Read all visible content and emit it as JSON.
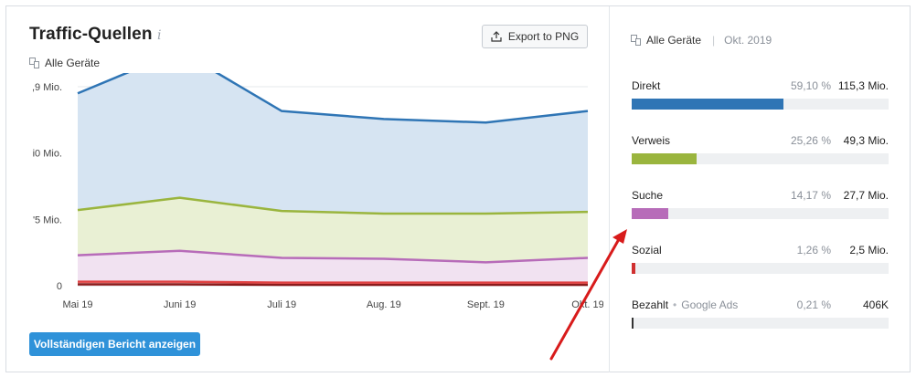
{
  "header": {
    "title": "Traffic-Quellen",
    "info_glyph": "i",
    "device_filter": "Alle Geräte",
    "export_label": "Export to PNG"
  },
  "chart_data": {
    "type": "area",
    "x": [
      "Mai 19",
      "Juni 19",
      "Juli 19",
      "Aug. 19",
      "Sept. 19",
      "Okt. 19"
    ],
    "y_tick_labels": [
      ",9 Mio.",
      "i0 Mio.",
      "'5 Mio.",
      "0"
    ],
    "y_tick_values": [
      225,
      150,
      75,
      0
    ],
    "ylim": [
      0,
      225
    ],
    "grid": true,
    "stacked": true,
    "series": [
      {
        "name": "Bezahlt",
        "color": "#8b1a1a",
        "values": [
          1.5,
          1.5,
          1.0,
          1.0,
          1.0,
          1.0
        ]
      },
      {
        "name": "Sozial",
        "color": "#e04040",
        "values": [
          3.0,
          3.0,
          2.5,
          2.5,
          2.5,
          2.5
        ]
      },
      {
        "name": "Suche",
        "color": "#b76cb9",
        "values": [
          30,
          35,
          28,
          27,
          23,
          28
        ]
      },
      {
        "name": "Verweis",
        "color": "#9ab53e",
        "values": [
          51,
          60,
          53,
          51,
          55,
          52
        ]
      },
      {
        "name": "Direkt",
        "color": "#2f75b5",
        "values": [
          132,
          166,
          113,
          107,
          103,
          114
        ]
      }
    ],
    "fills": {
      "Bezahlt": "#f3d6d6",
      "Sozial": "#f6e1e1",
      "Suche": "#f1e2f1",
      "Verweis": "#e9f0d4",
      "Direkt": "#d6e4f2"
    }
  },
  "report_button": "Vollständigen Bericht anzeigen",
  "right": {
    "device": "Alle Geräte",
    "separator": "|",
    "date": "Okt. 2019",
    "sources": [
      {
        "name": "Direkt",
        "sub": "",
        "pct": "59,10 %",
        "abs": "115,3 Mio.",
        "share": 0.591,
        "color": "#2f75b5"
      },
      {
        "name": "Verweis",
        "sub": "",
        "pct": "25,26 %",
        "abs": "49,3 Mio.",
        "share": 0.2526,
        "color": "#9ab53e"
      },
      {
        "name": "Suche",
        "sub": "",
        "pct": "14,17 %",
        "abs": "27,7 Mio.",
        "share": 0.1417,
        "color": "#b76cb9"
      },
      {
        "name": "Sozial",
        "sub": "",
        "pct": "1,26 %",
        "abs": "2,5 Mio.",
        "share": 0.0126,
        "color": "#d03030"
      },
      {
        "name": "Bezahlt",
        "sub": "Google Ads",
        "dot": "•",
        "pct": "0,21 %",
        "abs": "406K",
        "share": 0.0021,
        "color": "#333333"
      }
    ]
  },
  "annotation": {
    "arrow_color": "#d81b1b"
  }
}
